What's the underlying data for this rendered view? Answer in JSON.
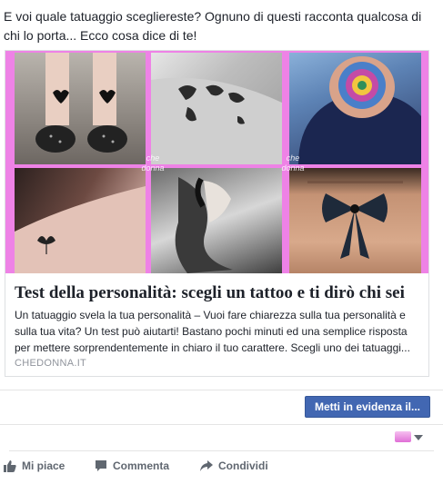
{
  "post": {
    "text": "E voi quale tatuaggio scegliereste? Ognuno di questi racconta qualcosa di chi lo porta... Ecco cosa dice di te!"
  },
  "card": {
    "watermark_text": "che donna",
    "title": "Test della personalità: scegli un tattoo e ti dirò chi sei",
    "description": "Un tatuaggio svela la tua personalità – Vuoi fare chiarezza sulla tua personalità e sulla tua vita? Un test può aiutarti! Bastano pochi minuti ed una semplice risposta per mettere sorprendentemente in chiaro il tuo carattere. Scegli uno dei tatuaggi...",
    "domain": "CHEDONNA.IT"
  },
  "boost": {
    "label": "Metti in evidenza il..."
  },
  "actions": {
    "like": "Mi piace",
    "comment": "Commenta",
    "share": "Condividi"
  },
  "colors": {
    "accent": "#4267b2",
    "collage_border": "#ee82e6",
    "action_text": "#606770",
    "domain_text": "#90949c"
  }
}
